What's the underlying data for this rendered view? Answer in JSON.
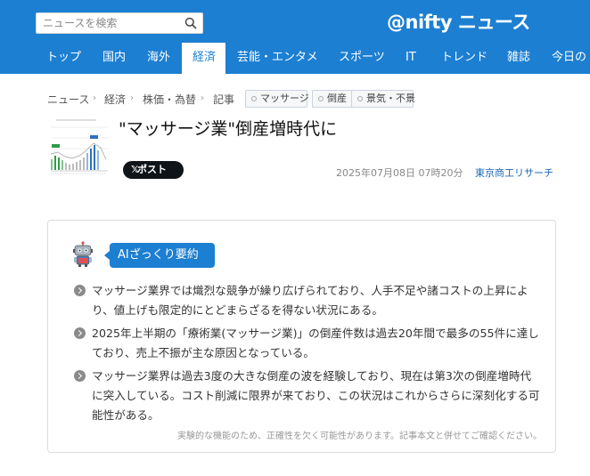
{
  "header": {
    "search_placeholder": "ニュースを検索",
    "logo": "@nifty ニュース"
  },
  "nav": [
    "トップ",
    "国内",
    "海外",
    "経済",
    "芸能・エンタメ",
    "スポーツ",
    "IT",
    "トレンド",
    "雑誌",
    "今日の"
  ],
  "nav_active": "経済",
  "breadcrumb": {
    "items": [
      "ニュース",
      "経済",
      "株価・為替",
      "記事"
    ],
    "tags": [
      "マッサージ",
      "倒産",
      "景気・不景"
    ]
  },
  "article": {
    "title": "\"マッサージ業\"倒産増時代に",
    "post_label": "ポスト",
    "date": "2025年07月08日 07時20分",
    "source": "東京商工リサーチ"
  },
  "summary": {
    "label": "AIざっくり要約",
    "bullets": [
      "マッサージ業界では熾烈な競争が繰り広げられており、人手不足や諸コストの上昇により、値上げも限定的にとどまらざるを得ない状況にある。",
      "2025年上半期の「療術業(マッサージ業)」の倒産件数は過去20年間で最多の55件に達しており、売上不振が主な原因となっている。",
      "マッサージ業界は過去3度の大きな倒産の波を経験しており、現在は第3次の倒産増時代に突入している。コスト削減に限界が来ており、この状況はこれからさらに深刻化する可能性がある。"
    ],
    "disclaimer": "実験的な機能のため、正確性を欠く可能性があります。記事本文と併せてご確認ください。"
  },
  "colors": {
    "brand": "#1c7fd2",
    "link": "#1c68b8"
  },
  "icons": {
    "search": "search-icon",
    "x": "x-logo-icon",
    "robot": "robot-icon",
    "bullet": "chevron-circle-icon"
  }
}
